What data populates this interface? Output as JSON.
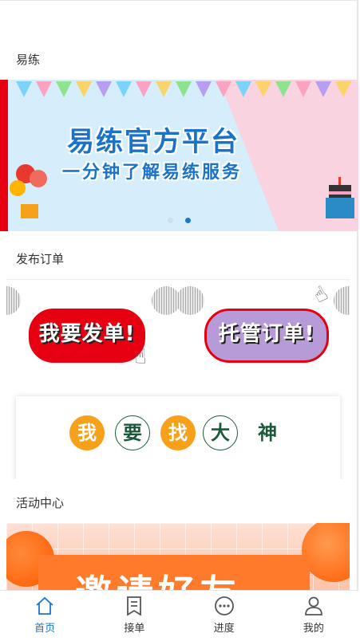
{
  "sections": {
    "yilian": "易练",
    "publish_order": "发布订单",
    "activity": "活动中心"
  },
  "banner": {
    "title": "易练官方平台",
    "subtitle": "一分钟了解易练服务",
    "active_dot": 2
  },
  "orders": {
    "post_order": "我要发单!",
    "custody_order": "托管订单!",
    "find_master": [
      "我",
      "要",
      "找",
      "大",
      "神"
    ]
  },
  "activity": {
    "banner_text": "邀请好友"
  },
  "tabbar": {
    "home": "首页",
    "take_order": "接单",
    "progress": "进度",
    "mine": "我的",
    "active_color": "#1976d2"
  }
}
